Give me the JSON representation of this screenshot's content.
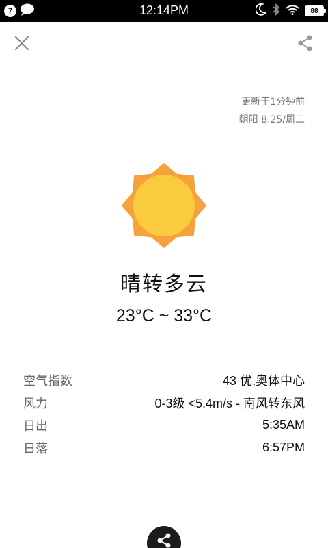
{
  "status_bar": {
    "notification_count": "7",
    "time": "12:14PM",
    "battery": "88"
  },
  "update": {
    "updated_text": "更新于1分钟前",
    "location_date": "朝阳  8.25/周二"
  },
  "weather": {
    "icon": "sun-icon",
    "condition": "晴转多云",
    "temp_range": "23°C ~ 33°C"
  },
  "details": [
    {
      "label": "空气指数",
      "value": "43 优,奥体中心"
    },
    {
      "label": "风力",
      "value": "0-3级 <5.4m/s - 南风转东风"
    },
    {
      "label": "日出",
      "value": "5:35AM"
    },
    {
      "label": "日落",
      "value": "6:57PM"
    }
  ],
  "colors": {
    "sun_outer": "#f6a23a",
    "sun_inner": "#fbcb3f",
    "status_bar": "#000000",
    "fab": "#1c1c1c"
  }
}
